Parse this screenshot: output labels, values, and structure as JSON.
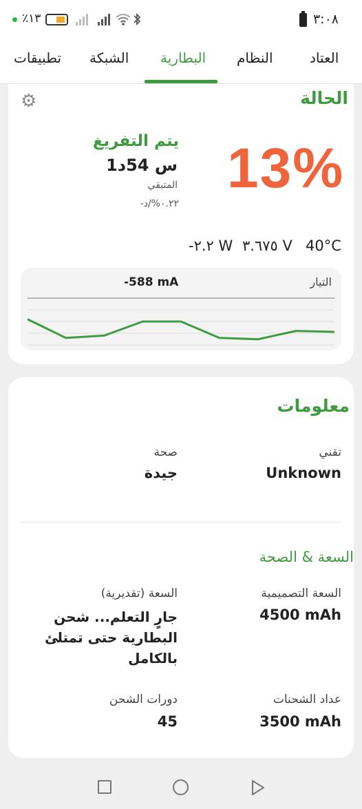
{
  "status_bar": {
    "battery_percent": "٪١٣",
    "time": "٣:٠٨",
    "icons": [
      "battery-icon",
      "signal-icon",
      "signal-icon",
      "wifi-icon",
      "bluetooth-icon",
      "battery-status-icon"
    ]
  },
  "tabs": [
    {
      "label": "العتاد",
      "active": false
    },
    {
      "label": "النظام",
      "active": false
    },
    {
      "label": "البطارية",
      "active": true
    },
    {
      "label": "الشبكة",
      "active": false
    },
    {
      "label": "تطبيقات",
      "active": false
    }
  ],
  "status_card": {
    "title": "الحالة",
    "settings_icon": "gear-icon",
    "level": "13%",
    "state": "يتم التفريغ",
    "remaining_time": "1س 54د",
    "remaining_label": "المتبقي",
    "rate": "-٠.٢٢%/د",
    "power": "-٢.٢ W",
    "voltage": "٣.٦٧٥ V",
    "temperature": "40°C",
    "current_label": "التيار",
    "current_value": "-588 mA",
    "current_chart": {
      "type": "line",
      "points": [
        0.55,
        0.15,
        0.2,
        0.5,
        0.5,
        0.15,
        0.12,
        0.3,
        0.28
      ]
    }
  },
  "info_card": {
    "title": "معلومات",
    "technology_label": "تقني",
    "technology_value": "Unknown",
    "health_label": "صحة",
    "health_value": "جيدة",
    "capacity_title": "السعة & الصحة",
    "design_capacity_label": "السعة التصميمية",
    "design_capacity_value": "4500 mAh",
    "estimated_capacity_label": "السعة (تقديرية)",
    "estimated_capacity_value": "جارٍ التعلم... شحن البطارية حتى تمتلئ بالكامل",
    "charge_counter_label": "عداد الشحنات",
    "charge_counter_value": "3500 mAh",
    "cycles_label": "دورات الشحن",
    "cycles_value": "45"
  },
  "colors": {
    "accent": "#3f9b3f",
    "level": "#f0643c"
  }
}
